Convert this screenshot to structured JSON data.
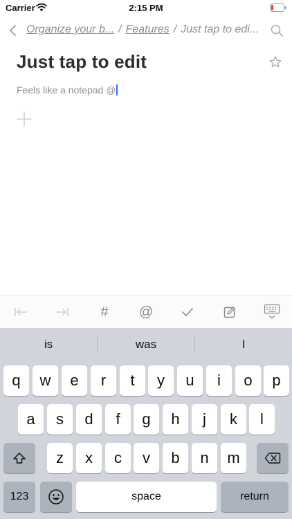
{
  "status_bar": {
    "carrier": "Carrier",
    "time": "2:15 PM"
  },
  "nav": {
    "breadcrumbs": [
      {
        "label": "Organize your b..."
      },
      {
        "label": "Features"
      }
    ],
    "separator": "/",
    "current": "Just tap to edi..."
  },
  "note": {
    "title": "Just tap to edit",
    "body": "Feels like a notepad @"
  },
  "toolbar": {
    "hashtag_label": "#",
    "mention_label": "@"
  },
  "keyboard": {
    "predictions": [
      "is",
      "was",
      "I"
    ],
    "row1": [
      "q",
      "w",
      "e",
      "r",
      "t",
      "y",
      "u",
      "i",
      "o",
      "p"
    ],
    "row2": [
      "a",
      "s",
      "d",
      "f",
      "g",
      "h",
      "j",
      "k",
      "l"
    ],
    "row3": [
      "z",
      "x",
      "c",
      "v",
      "b",
      "n",
      "m"
    ],
    "numbers_label": "123",
    "space_label": "space",
    "return_label": "return"
  },
  "colors": {
    "caret": "#2f6bff",
    "keyboard_bg": "#d1d4da",
    "key_bg": "#ffffff",
    "dark_key_bg": "#adb3bc",
    "muted_text": "#8e8e93"
  }
}
